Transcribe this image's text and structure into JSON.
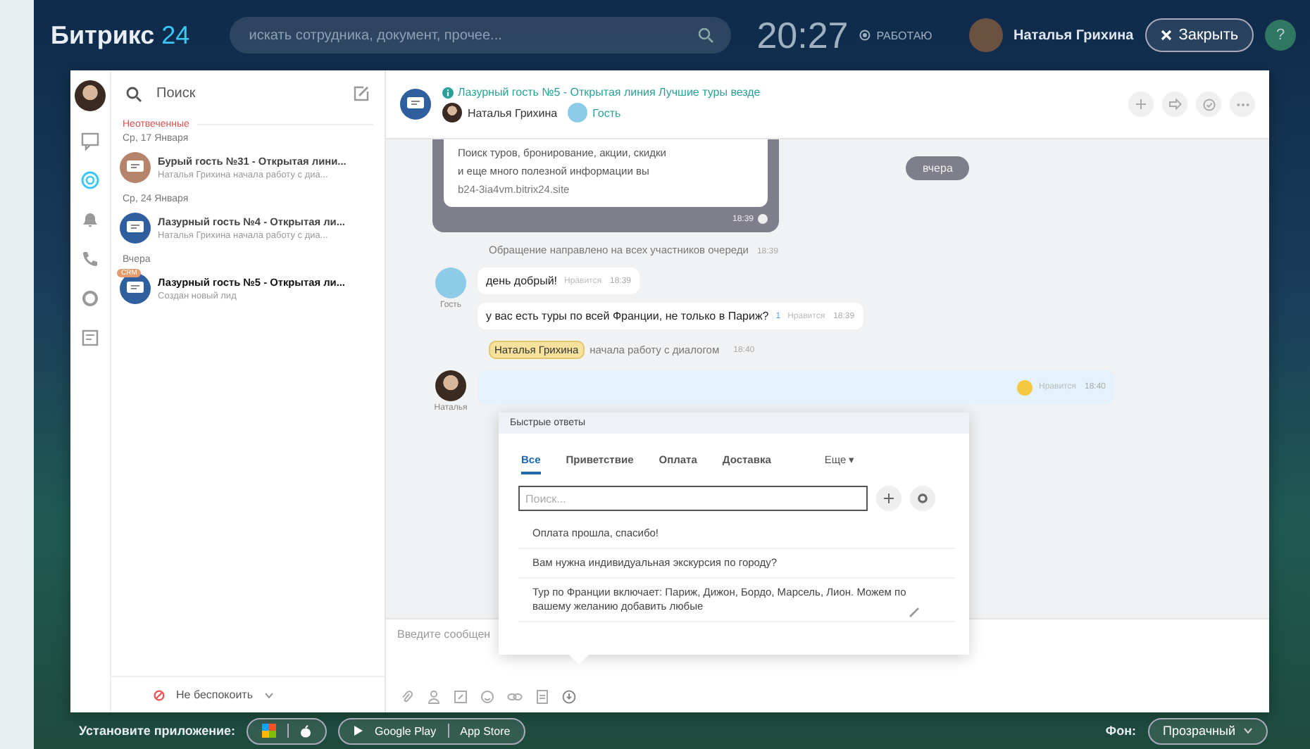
{
  "topbar": {
    "logo": "Битрикс",
    "logo_suffix": "24",
    "search": {
      "placeholder": "искать сотрудника, документ, прочее..."
    },
    "clock": "20:27",
    "status": "РАБОТАЮ",
    "user": "Наталья Грихина",
    "close_button": "Закрыть",
    "help_button": "?"
  },
  "chat_list": {
    "search": {
      "placeholder": "Поиск"
    },
    "section": "Неотвеченные",
    "groups": [
      {
        "date": "Ср, 17 Января",
        "items": [
          {
            "title": "Бурый гость №31 - Открытая лини...",
            "subtitle": "Наталья Грихина начала работу с диа...",
            "color": "#b5846a",
            "selected": false
          }
        ]
      },
      {
        "date": "Ср, 24 Января",
        "items": [
          {
            "title": "Лазурный гость №4 - Открытая ли...",
            "subtitle": "Наталья Грихина начала работу с диа...",
            "color": "#2f5f9e",
            "selected": false
          }
        ]
      },
      {
        "date": "Вчера",
        "items": [
          {
            "title": "Лазурный гость №5 - Открытая ли...",
            "subtitle": "Создан новый лид",
            "color": "#2f5f9e",
            "badge": "CRM",
            "selected": true
          }
        ]
      }
    ],
    "dnd": "Не беспокоить"
  },
  "chat": {
    "title": "Лазурный гость №5 - Открытая линия Лучшие туры везде",
    "members": [
      "Наталья Грихина",
      "Гость"
    ],
    "card": {
      "lines": [
        "Поиск туров, бронирование, акции, скидки",
        "и еще много полезной информации вы"
      ],
      "link": "b24-3ia4vm.bitrix24.site",
      "time": "18:39"
    },
    "date_pill": "вчера",
    "system": {
      "text": "Обращение направлено на всех участников очереди",
      "time": "18:39"
    },
    "guest": {
      "name": "Гость",
      "messages": [
        {
          "text": "день добрый!",
          "like": "Нравится",
          "time": "18:39"
        },
        {
          "text": "у вас есть туры по всей Франции, не только в Париж?",
          "likes": "1",
          "like": "Нравится",
          "time": "18:39"
        }
      ]
    },
    "started": {
      "name": "Наталья Грихина",
      "text": "начала работу с диалогом",
      "time": "18:40"
    },
    "operator": {
      "name": "Наталья",
      "like": "Нравится",
      "time": "18:40"
    },
    "input": {
      "placeholder": "Введите сообщен"
    }
  },
  "quick_answers": {
    "title": "Быстрые ответы",
    "tabs": [
      {
        "label": "Все",
        "selected": true
      },
      {
        "label": "Приветствие",
        "selected": false
      },
      {
        "label": "Оплата",
        "selected": false
      },
      {
        "label": "Доставка",
        "selected": false
      },
      {
        "label": "Еще ▾",
        "selected": false
      }
    ],
    "search": {
      "placeholder": "Поиск..."
    },
    "items": [
      "Оплата прошла, спасибо!",
      "Вам нужна индивидуальная экскурсия по городу?",
      "Тур по Франции включает: Париж, Дижон, Бордо, Марсель, Лион. Можем по вашему желанию добавить любые"
    ]
  },
  "bottombar": {
    "install": "Установите приложение:",
    "google_play": "Google Play",
    "app_store": "App Store",
    "bg_label": "Фон:",
    "bg_value": "Прозрачный"
  }
}
